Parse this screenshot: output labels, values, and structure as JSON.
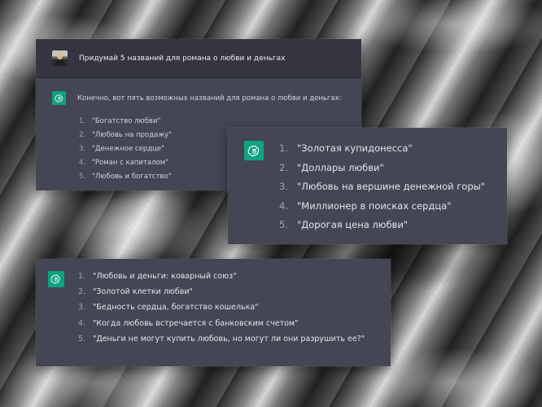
{
  "colors": {
    "panel_bg": "#444654",
    "user_row_bg": "#343541",
    "gpt_logo_bg": "#10a37f",
    "text": "#d1d5db"
  },
  "icons": {
    "user": "avatar",
    "assistant": "chatgpt-logo-icon"
  },
  "chat1": {
    "user_prompt": "Придумай 5 названий для романа о любви и деньгах",
    "assistant_intro": "Конечно, вот пять возможных названий для романа о любви и деньгах:",
    "items": [
      {
        "num": "1.",
        "text": "\"Богатство любви\""
      },
      {
        "num": "2.",
        "text": "\"Любовь на продажу\""
      },
      {
        "num": "3.",
        "text": "\"Денежное сердце\""
      },
      {
        "num": "4.",
        "text": "\"Роман с капиталом\""
      },
      {
        "num": "5.",
        "text": "\"Любовь и богатство\""
      }
    ]
  },
  "chat2": {
    "items": [
      {
        "num": "1.",
        "text": "\"Золотая купидонесса\""
      },
      {
        "num": "2.",
        "text": "\"Доллары любви\""
      },
      {
        "num": "3.",
        "text": "\"Любовь на вершине денежной горы\""
      },
      {
        "num": "4.",
        "text": "\"Миллионер в поисках сердца\""
      },
      {
        "num": "5.",
        "text": "\"Дорогая цена любви\""
      }
    ]
  },
  "chat3": {
    "items": [
      {
        "num": "1.",
        "text": "\"Любовь и деньги: коварный союз\""
      },
      {
        "num": "2.",
        "text": "\"Золотой клетки любви\""
      },
      {
        "num": "3.",
        "text": "\"Бедность сердца, богатство кошелька\""
      },
      {
        "num": "4.",
        "text": "\"Когда любовь встречается с банковским счетом\""
      },
      {
        "num": "5.",
        "text": "\"Деньги не могут купить любовь, но могут ли они разрушить ее?\""
      }
    ]
  }
}
